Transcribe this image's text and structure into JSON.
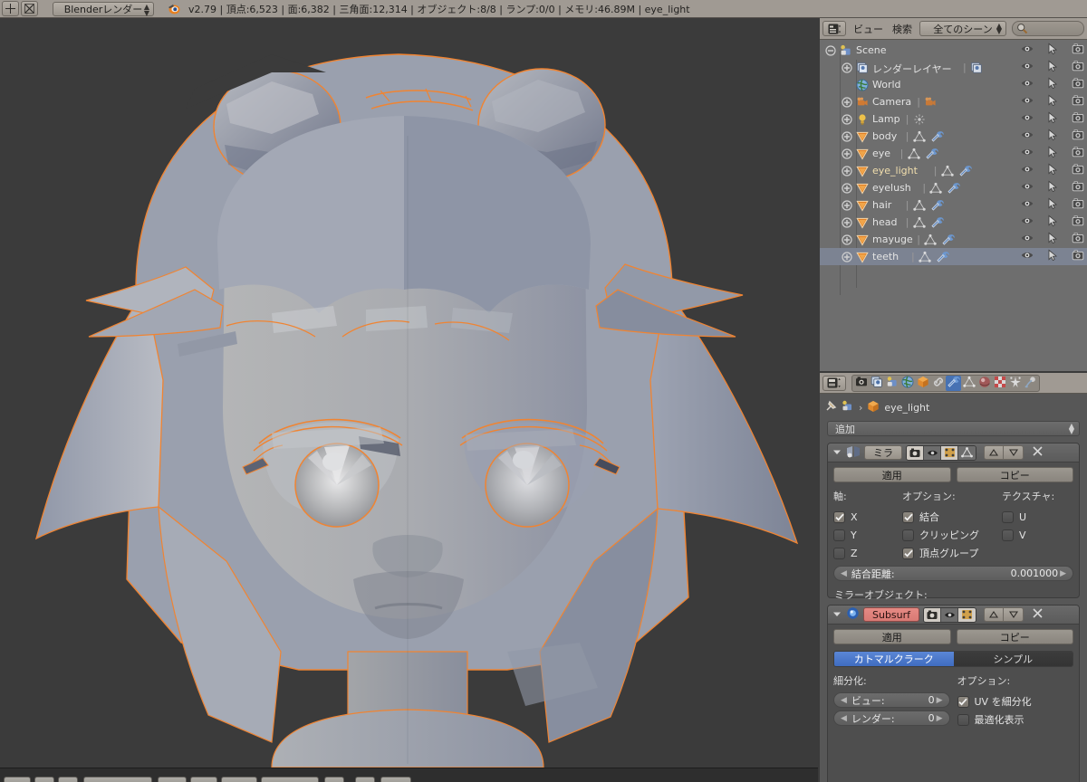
{
  "topbar": {
    "add_icon": "plus-icon",
    "close_icon": "x-icon",
    "engine": "Blenderレンダー",
    "logo_icon": "blender-logo-icon",
    "status": "v2.79 | 頂点:6,523 | 面:6,382 | 三角面:12,314 | オブジェクト:8/8 | ランプ:0/0 | メモリ:46.89M | eye_light",
    "stats": {
      "version": "v2.79",
      "verts_label": "頂点",
      "verts": "6,523",
      "faces_label": "面",
      "faces": "6,382",
      "tris_label": "三角面",
      "tris": "12,314",
      "objects_label": "オブジェクト",
      "objects": "8/8",
      "lamps_label": "ランプ",
      "lamps": "0/0",
      "mem_label": "メモリ",
      "mem": "46.89M",
      "active_object": "eye_light"
    }
  },
  "outliner": {
    "editor_type_icon": "outliner-editor-icon",
    "menus": [
      "ビュー",
      "検索"
    ],
    "scene_filter": "全てのシーン",
    "search_icon": "search-icon",
    "column_icons": [
      "eye-icon",
      "cursor-arrow-icon",
      "camera-icon"
    ],
    "rows": [
      {
        "label": "Scene",
        "indent": 0,
        "icon": "scene-icon",
        "expander": "minus",
        "highlight": false,
        "selected": false,
        "extras": []
      },
      {
        "label": "レンダーレイヤー",
        "indent": 1,
        "icon": "renderlayer-icon",
        "expander": "plus",
        "highlight": false,
        "selected": false,
        "extras": [
          "renderlayer-icon"
        ]
      },
      {
        "label": "World",
        "indent": 1,
        "icon": "world-icon",
        "expander": "none",
        "highlight": false,
        "selected": false,
        "extras": []
      },
      {
        "label": "Camera",
        "indent": 1,
        "icon": "camera-data-icon",
        "expander": "plus",
        "highlight": false,
        "selected": false,
        "extras": [
          "camera-data-icon"
        ]
      },
      {
        "label": "Lamp",
        "indent": 1,
        "icon": "lamp-icon",
        "expander": "plus",
        "highlight": false,
        "selected": false,
        "extras": [
          "lampdata-icon"
        ]
      },
      {
        "label": "body",
        "indent": 1,
        "icon": "mesh-object-icon",
        "expander": "plus",
        "highlight": false,
        "selected": false,
        "extras": [
          "mesh-data-icon",
          "wrench-icon"
        ]
      },
      {
        "label": "eye",
        "indent": 1,
        "icon": "mesh-object-icon",
        "expander": "plus",
        "highlight": false,
        "selected": false,
        "extras": [
          "mesh-data-icon",
          "wrench-icon"
        ]
      },
      {
        "label": "eye_light",
        "indent": 1,
        "icon": "mesh-object-icon",
        "expander": "plus",
        "highlight": true,
        "selected": false,
        "extras": [
          "mesh-data-icon",
          "wrench-icon"
        ]
      },
      {
        "label": "eyelush",
        "indent": 1,
        "icon": "mesh-object-icon",
        "expander": "plus",
        "highlight": false,
        "selected": false,
        "extras": [
          "mesh-data-icon",
          "wrench-icon"
        ]
      },
      {
        "label": "hair",
        "indent": 1,
        "icon": "mesh-object-icon",
        "expander": "plus",
        "highlight": false,
        "selected": false,
        "extras": [
          "mesh-data-icon",
          "wrench-icon"
        ]
      },
      {
        "label": "head",
        "indent": 1,
        "icon": "mesh-object-icon",
        "expander": "plus",
        "highlight": false,
        "selected": false,
        "extras": [
          "mesh-data-icon",
          "wrench-icon"
        ]
      },
      {
        "label": "mayuge",
        "indent": 1,
        "icon": "mesh-object-icon",
        "expander": "plus",
        "highlight": false,
        "selected": false,
        "extras": [
          "mesh-data-icon",
          "wrench-icon"
        ]
      },
      {
        "label": "teeth",
        "indent": 1,
        "icon": "mesh-object-icon",
        "expander": "plus",
        "highlight": false,
        "selected": true,
        "extras": [
          "mesh-data-icon",
          "wrench-icon"
        ]
      }
    ]
  },
  "properties": {
    "editor_type_icon": "properties-editor-icon",
    "tabs": [
      {
        "name": "render-tab",
        "icon": "camera-back-icon",
        "active": false
      },
      {
        "name": "renderlayers-tab",
        "icon": "images-icon",
        "active": false
      },
      {
        "name": "scene-tab",
        "icon": "scene-props-icon",
        "active": false
      },
      {
        "name": "world-tab",
        "icon": "world-icon",
        "active": false
      },
      {
        "name": "object-tab",
        "icon": "orange-cube-icon",
        "active": false
      },
      {
        "name": "constraints-tab",
        "icon": "chain-link-icon",
        "active": false
      },
      {
        "name": "modifiers-tab",
        "icon": "wrench-icon",
        "active": true
      },
      {
        "name": "data-tab",
        "icon": "mesh-data-icon",
        "active": false
      },
      {
        "name": "material-tab",
        "icon": "material-sphere-icon",
        "active": false
      },
      {
        "name": "texture-tab",
        "icon": "checker-icon",
        "active": false
      },
      {
        "name": "particles-tab",
        "icon": "particles-icon",
        "active": false
      },
      {
        "name": "physics-tab",
        "icon": "physics-icon",
        "active": false
      }
    ],
    "breadcrumb": {
      "pin_icon": "pin-icon",
      "object_icon": "scene-icon",
      "chevron": "›",
      "cube_icon": "orange-cube-icon",
      "object_name": "eye_light"
    },
    "add_modifier": "追加",
    "modifiers": [
      {
        "name": "ミラ",
        "name_is_red": false,
        "collapse_icon": "chevron-down-icon",
        "type_icon": "mirror-modifier-icon",
        "toggles": [
          {
            "name": "render-toggle",
            "icon": "camera-back-icon",
            "on": true
          },
          {
            "name": "viewport-toggle",
            "icon": "eye-icon",
            "on": false
          },
          {
            "name": "editmode-toggle",
            "icon": "editmode-icon",
            "on": true
          },
          {
            "name": "cage-toggle",
            "icon": "mesh-data-icon",
            "on": false
          }
        ],
        "move_up_icon": "triangle-up-icon",
        "move_down_icon": "triangle-down-icon",
        "delete_icon": "x-icon",
        "apply": "適用",
        "copy": "コピー",
        "columns": [
          {
            "header": "軸:",
            "items": [
              {
                "label": "X",
                "checked": true
              },
              {
                "label": "Y",
                "checked": false
              },
              {
                "label": "Z",
                "checked": false
              }
            ]
          },
          {
            "header": "オプション:",
            "items": [
              {
                "label": "結合",
                "checked": true
              },
              {
                "label": "クリッピング",
                "checked": false
              },
              {
                "label": "頂点グループ",
                "checked": true
              }
            ]
          },
          {
            "header": "テクスチャ:",
            "items": [
              {
                "label": "U",
                "checked": false
              },
              {
                "label": "V",
                "checked": false
              }
            ]
          }
        ],
        "merge_limit_label": "結合距離:",
        "merge_limit_value": "0.001000",
        "mirror_object_label": "ミラーオブジェクト:",
        "mirror_object_value": "",
        "eyedropper_icon": "eyedropper-icon"
      },
      {
        "name": "Subsurf",
        "name_is_red": true,
        "collapse_icon": "chevron-down-icon",
        "type_icon": "subsurf-modifier-icon",
        "toggles": [
          {
            "name": "render-toggle",
            "icon": "camera-back-icon",
            "on": true
          },
          {
            "name": "viewport-toggle",
            "icon": "eye-icon",
            "on": false
          },
          {
            "name": "editmode-toggle",
            "icon": "editmode-icon",
            "on": true
          }
        ],
        "move_up_icon": "triangle-up-icon",
        "move_down_icon": "triangle-down-icon",
        "delete_icon": "x-icon",
        "apply": "適用",
        "copy": "コピー",
        "algo_catmull": "カトマルクラーク",
        "algo_simple": "シンプル",
        "subdivisions_label": "細分化:",
        "options_label": "オプション:",
        "view_label": "ビュー:",
        "view_value": "0",
        "render_label": "レンダー:",
        "render_value": "0",
        "subdivide_uvs": "UV を細分化",
        "subdivide_uvs_checked": true,
        "optimal_display": "最適化表示",
        "optimal_display_checked": false
      }
    ]
  },
  "viewport": {
    "background_color": "#3b3b3b",
    "selection_outline_color": "#f08432",
    "model_description": "低ポリゴン アニメ風キャラクターの頭部",
    "shading": "solid"
  },
  "colors": {
    "header_bg": "#a09a93",
    "outliner_bg": "#6e6e6e",
    "properties_bg": "#575757",
    "panel_bg": "#4e4e4e",
    "accent_blue": "#4772b3",
    "accent_red": "#e0837d",
    "selected_row": "#7c8392",
    "highlight_text": "#f2dfae"
  }
}
